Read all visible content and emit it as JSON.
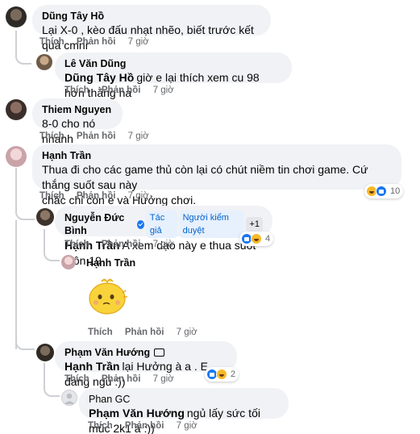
{
  "actions": {
    "like": "Thích",
    "reply": "Phản hồi"
  },
  "colors": {
    "bubble": "#f0f2f5",
    "meta": "#65676b",
    "verified": "#1877f2",
    "badge_blue": "#0064d1"
  },
  "comments": [
    {
      "author": "Dũng Tây Hồ",
      "text": "Lại X-0 , kèo đấu nhạt nhẽo, biết trước kết quả cmnr",
      "time": "7 giờ",
      "avatar": "avatar-dung-tay-ho"
    },
    {
      "author": "Lê Văn Dũng",
      "mention": "Dũng Tây Hồ",
      "text": "giờ e lại thích xem cu 98 hơn thằng ha",
      "time": "7 giờ",
      "avatar": "avatar-le-van-dung"
    },
    {
      "author": "Thiem Nguyen",
      "text": "8-0 cho nó nhanh",
      "time": "7 giờ",
      "avatar": "avatar-thiem-nguyen"
    },
    {
      "author": "Hạnh Trần",
      "text_line1": "Thua đi cho các game thủ còn lại có chút niềm tin chơi game. Cứ thắng suốt sau này",
      "text_line2": "chắc chỉ còn e và Hưởng chơi.",
      "time": "7 giờ",
      "reactions": {
        "icons": [
          "haha",
          "like"
        ],
        "count": "10"
      },
      "avatar": "avatar-hanh-tran"
    },
    {
      "author": "Nguyễn Đức Bình",
      "badges": [
        "Tác giả",
        "Người kiểm duyệt",
        "+1"
      ],
      "mention": "Hạnh Trần",
      "text": "A xem dạo này e thua suốt luôn 19",
      "time": "7 giờ",
      "reactions": {
        "icons": [
          "like",
          "haha"
        ],
        "count": "4"
      },
      "avatar": "avatar-nguyen-duc-binh"
    },
    {
      "author": "Hạnh Trần",
      "sticker": "sticker-yellow-chick",
      "time": "7 giờ",
      "avatar": "avatar-hanh-tran-small"
    },
    {
      "author": "Phạm Văn Hướng",
      "mention": "Hạnh Trần",
      "text": "lại Hưởng à a . E đang ngủ :))",
      "time": "7 giờ",
      "reactions": {
        "icons": [
          "like",
          "haha"
        ],
        "count": "2"
      },
      "avatar": "avatar-pham-van-huong"
    },
    {
      "author": "Phan GC",
      "mention": "Phạm Văn Hướng",
      "text": "ngủ lấy sức tối múc 2k1 à :))",
      "time": "7 giờ",
      "avatar": "avatar-phan-gc"
    }
  ]
}
